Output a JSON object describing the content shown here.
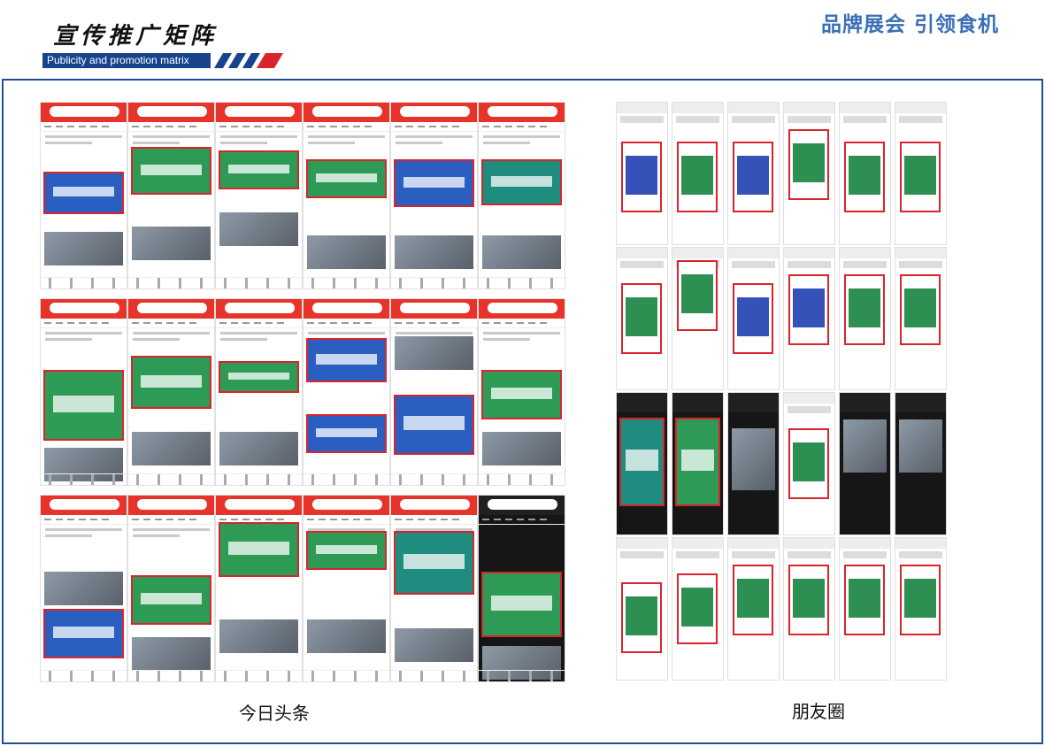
{
  "header": {
    "title_cn": "宣传推广矩阵",
    "title_en": "Publicity and promotion matrix",
    "slogan": "品牌展会 引领食机"
  },
  "captions": {
    "left": "今日头条",
    "right": "朋友圈"
  },
  "colors": {
    "brand_blue": "#17438c",
    "slogan_blue": "#3b6fb7",
    "accent_red": "#d9242b",
    "frame_blue": "#1f4e95"
  }
}
